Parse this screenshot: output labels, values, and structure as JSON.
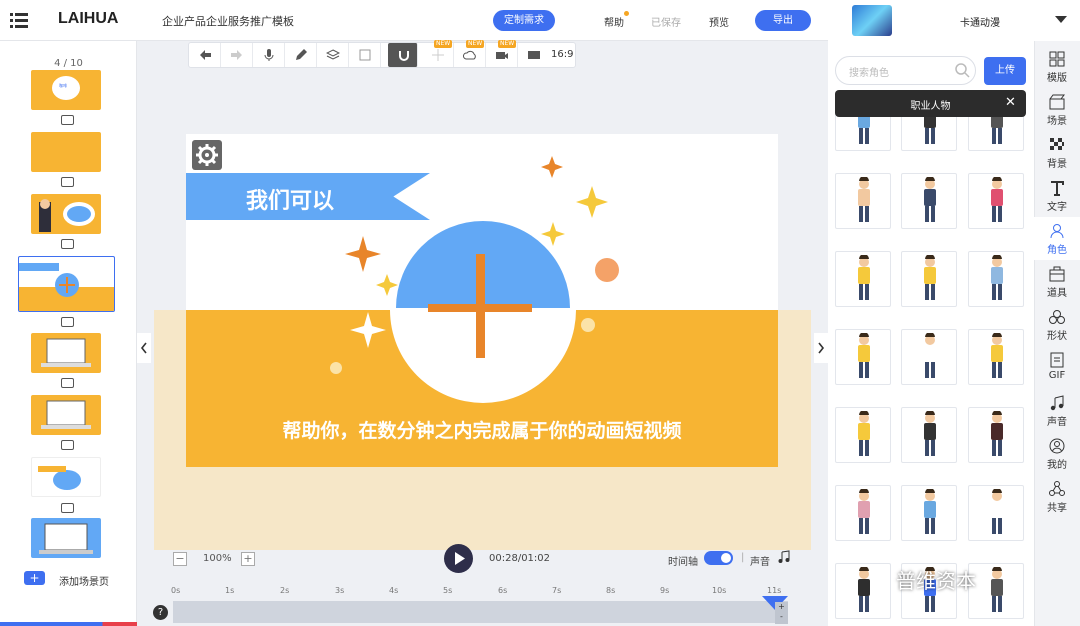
{
  "header": {
    "logo": "LAIHUA",
    "doc_title": "企业产品企业服务推广模板",
    "custom_label": "定制需求",
    "help_label": "帮助",
    "saved_label": "已保存",
    "preview_label": "预览",
    "export_label": "导出"
  },
  "scenes": {
    "counter": "4 / 10",
    "add_label": "添加场景页"
  },
  "toolbar": {
    "new_badge": "NEW",
    "ratio": "16:9"
  },
  "stage": {
    "banner_text": "我们可以",
    "subtitle": "帮助你，在数分钟之内完成属于你的动画短视频"
  },
  "playback": {
    "zoom": "100%",
    "zoom_minus": "−",
    "zoom_plus": "+",
    "time": "00:28/01:02",
    "timeline_label": "时间轴",
    "separator": "|",
    "sound_label": "声音"
  },
  "ruler": {
    "ticks": [
      "0s",
      "1s",
      "2s",
      "3s",
      "4s",
      "5s",
      "6s",
      "7s",
      "8s",
      "9s",
      "10s",
      "11s"
    ],
    "help": "?",
    "zoom_in": "+",
    "zoom_out": "-"
  },
  "assets": {
    "category_title": "卡通动漫",
    "search_placeholder": "搜索角色",
    "upload_label": "上传",
    "tooltip_text": "职业人物",
    "tooltip_close": "✕"
  },
  "side_nav": [
    {
      "label": "模版",
      "icon": "template-icon"
    },
    {
      "label": "场景",
      "icon": "scene-icon"
    },
    {
      "label": "背景",
      "icon": "background-icon"
    },
    {
      "label": "文字",
      "icon": "text-icon"
    },
    {
      "label": "角色",
      "icon": "character-icon"
    },
    {
      "label": "道具",
      "icon": "prop-icon"
    },
    {
      "label": "形状",
      "icon": "shape-icon"
    },
    {
      "label": "GIF",
      "icon": "gif-icon"
    },
    {
      "label": "声音",
      "icon": "sound-icon"
    },
    {
      "label": "我的",
      "icon": "user-icon"
    },
    {
      "label": "共享",
      "icon": "share-icon"
    }
  ],
  "watermark": "普维资本",
  "colors": {
    "accent": "#3e6ff0",
    "stage_orange": "#f7b433",
    "banner_blue": "#62a8f5"
  }
}
